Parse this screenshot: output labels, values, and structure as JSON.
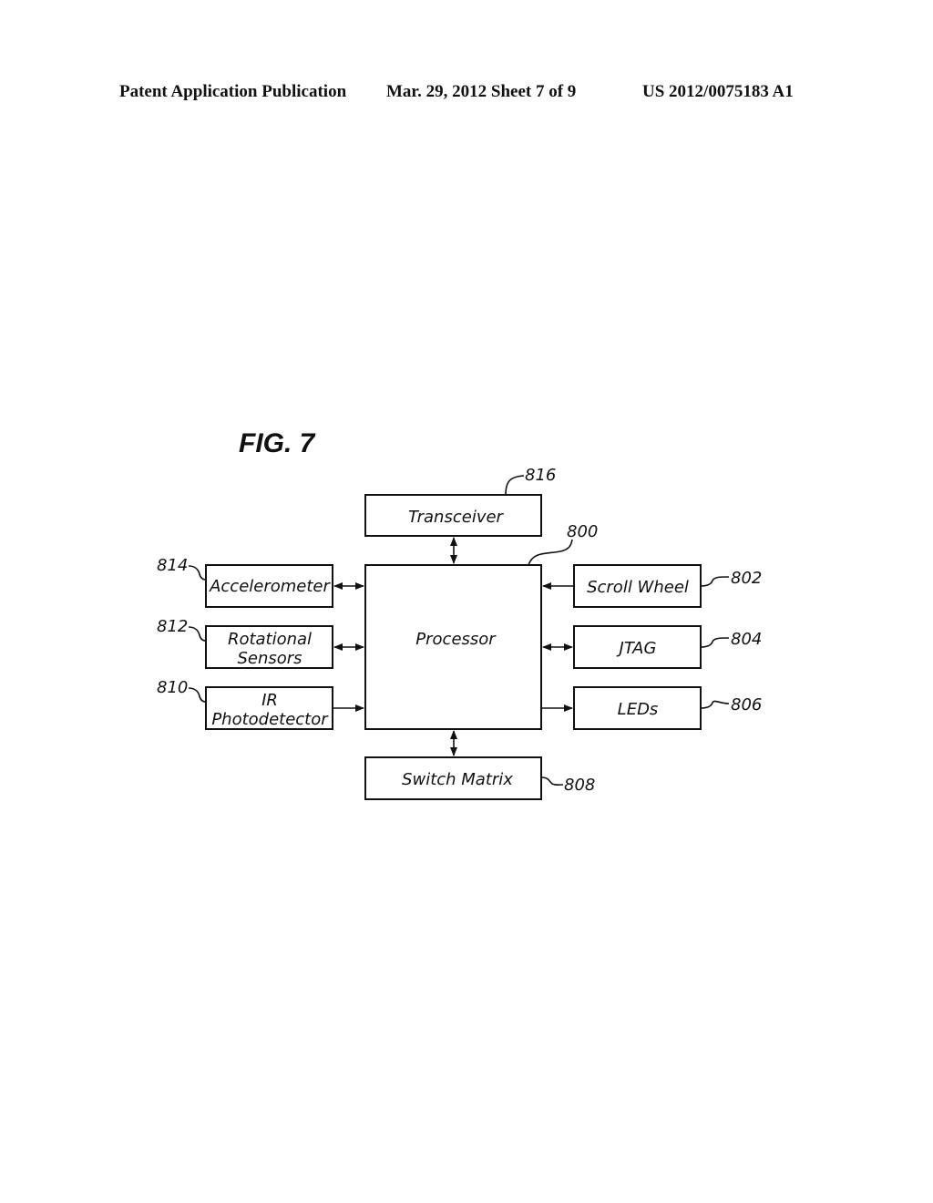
{
  "header": {
    "publication": "Patent Application Publication",
    "date_sheet": "Mar. 29, 2012  Sheet 7 of 9",
    "number": "US 2012/0075183 A1"
  },
  "figure": {
    "title": "FIG. 7",
    "blocks": {
      "transceiver": {
        "label": "Transceiver",
        "ref": "816"
      },
      "processor": {
        "label": "Processor",
        "ref": "800"
      },
      "accelerometer": {
        "label": "Accelerometer",
        "ref": "814"
      },
      "rotational": {
        "line1": "Rotational",
        "line2": "Sensors",
        "ref": "812"
      },
      "ir": {
        "line1": "IR",
        "line2": "Photodetector",
        "ref": "810"
      },
      "scroll": {
        "label": "Scroll  Wheel",
        "ref": "802"
      },
      "jtag": {
        "label": "JTAG",
        "ref": "804"
      },
      "leds": {
        "label": "LEDs",
        "ref": "806"
      },
      "switch": {
        "label": "Switch  Matrix",
        "ref": "808"
      }
    },
    "connections": [
      {
        "from": "transceiver",
        "to": "processor",
        "direction": "bidirectional"
      },
      {
        "from": "accelerometer",
        "to": "processor",
        "direction": "bidirectional"
      },
      {
        "from": "rotational",
        "to": "processor",
        "direction": "bidirectional"
      },
      {
        "from": "ir",
        "to": "processor",
        "direction": "to-processor"
      },
      {
        "from": "scroll",
        "to": "processor",
        "direction": "to-processor"
      },
      {
        "from": "jtag",
        "to": "processor",
        "direction": "bidirectional"
      },
      {
        "from": "processor",
        "to": "leds",
        "direction": "to-leds"
      },
      {
        "from": "switch",
        "to": "processor",
        "direction": "bidirectional"
      }
    ]
  }
}
